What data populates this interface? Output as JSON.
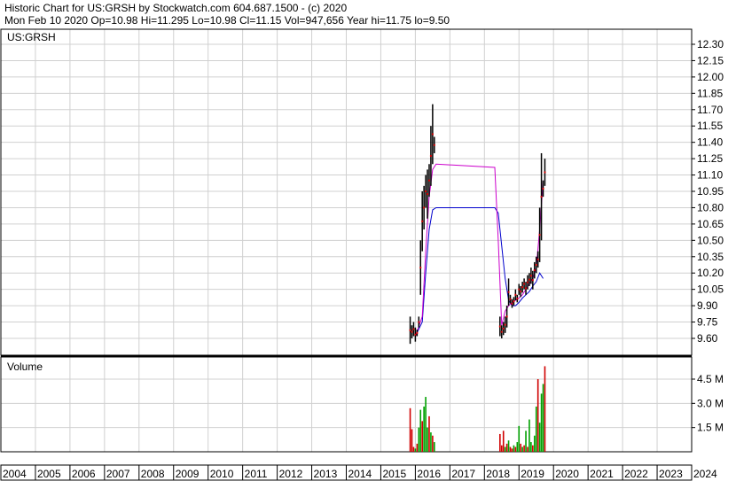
{
  "header": {
    "line1": "Historic Chart for US:GRSH by Stockwatch.com 604.687.1500 - (c) 2020",
    "line2": "Mon Feb 10 2020   Op=10.98  Hi=11.295  Lo=10.98  Cl=11.15  Vol=947,656  Year hi=11.75  lo=9.50"
  },
  "chart_data": [
    {
      "type": "line",
      "title": "US:GRSH",
      "xlabel": "",
      "ylabel": "",
      "x_ticks": [
        "2004",
        "2005",
        "2006",
        "2007",
        "2008",
        "2009",
        "2010",
        "2011",
        "2012",
        "2013",
        "2014",
        "2015",
        "2016",
        "2017",
        "2018",
        "2019",
        "2020",
        "2021",
        "2022",
        "2023",
        "2024"
      ],
      "y_ticks": [
        "9.60",
        "9.75",
        "9.90",
        "10.05",
        "10.20",
        "10.35",
        "10.50",
        "10.65",
        "10.80",
        "10.95",
        "11.10",
        "11.25",
        "11.40",
        "11.55",
        "11.70",
        "11.85",
        "12.00",
        "12.15",
        "12.30"
      ],
      "ylim": [
        9.45,
        12.38
      ],
      "grid": true,
      "colors": {
        "price": "#000000",
        "ma_short": "#0000cc",
        "ma_long": "#cc00cc",
        "up_volume": "#00a000",
        "down_volume": "#d00000"
      },
      "series": [
        {
          "style": "price-bars",
          "x": [
            2015.85,
            2015.9,
            2015.95,
            2016.0,
            2016.05,
            2016.1,
            2016.15,
            2016.2,
            2016.25,
            2016.3,
            2016.35,
            2016.4,
            2016.45,
            2016.5,
            2016.55,
            2018.45,
            2018.5,
            2018.55,
            2018.6,
            2018.65,
            2018.7,
            2018.75,
            2018.8,
            2018.85,
            2018.9,
            2018.95,
            2019.0,
            2019.05,
            2019.1,
            2019.15,
            2019.2,
            2019.25,
            2019.3,
            2019.35,
            2019.4,
            2019.45,
            2019.5,
            2019.55,
            2019.6,
            2019.65,
            2019.7,
            2019.75
          ],
          "low": [
            9.55,
            9.6,
            9.62,
            9.57,
            9.62,
            9.7,
            10.0,
            10.4,
            10.6,
            10.8,
            10.7,
            10.9,
            11.0,
            11.2,
            11.3,
            9.62,
            9.6,
            9.63,
            9.65,
            9.7,
            9.9,
            9.92,
            9.88,
            9.9,
            9.95,
            9.93,
            10.0,
            9.98,
            10.02,
            10.05,
            10.0,
            10.05,
            10.08,
            10.1,
            10.05,
            10.15,
            10.2,
            10.25,
            10.3,
            10.5,
            10.9,
            11.0
          ],
          "high": [
            9.8,
            9.72,
            9.75,
            9.7,
            9.68,
            9.8,
            10.5,
            10.95,
            11.0,
            11.1,
            11.15,
            11.2,
            11.55,
            11.75,
            11.45,
            9.8,
            9.72,
            9.75,
            9.8,
            9.9,
            10.15,
            10.0,
            9.96,
            9.98,
            10.05,
            10.0,
            10.1,
            10.08,
            10.12,
            10.15,
            10.12,
            10.18,
            10.2,
            10.25,
            10.22,
            10.3,
            10.35,
            10.4,
            10.8,
            11.3,
            11.05,
            11.25
          ]
        },
        {
          "name": "",
          "style": "moving-average-short",
          "x": [
            2016.0,
            2016.2,
            2016.3,
            2016.4,
            2016.5,
            2016.6,
            2018.3,
            2018.4,
            2018.5,
            2018.6,
            2018.7,
            2018.8,
            2018.9,
            2019.0,
            2019.1,
            2019.2,
            2019.3,
            2019.4,
            2019.5,
            2019.6,
            2019.7
          ],
          "values": [
            9.62,
            9.75,
            10.2,
            10.6,
            10.78,
            10.8,
            10.8,
            10.75,
            10.45,
            10.15,
            9.95,
            9.9,
            9.9,
            9.93,
            9.97,
            10.0,
            10.03,
            10.08,
            10.12,
            10.2,
            10.15
          ]
        },
        {
          "name": "",
          "style": "moving-average-long",
          "x": [
            2016.0,
            2016.2,
            2016.3,
            2016.4,
            2016.5,
            2016.6,
            2018.3,
            2018.4,
            2018.5,
            2018.6,
            2018.7,
            2018.8,
            2018.9,
            2019.0,
            2019.1,
            2019.2,
            2019.3,
            2019.4,
            2019.5,
            2019.6,
            2019.7
          ],
          "values": [
            9.62,
            9.8,
            10.4,
            10.9,
            11.15,
            11.2,
            11.17,
            10.5,
            9.72,
            9.85,
            9.9,
            9.93,
            9.95,
            9.97,
            10.0,
            10.05,
            10.1,
            10.15,
            10.25,
            10.6,
            11.05
          ]
        }
      ]
    },
    {
      "type": "bar",
      "title": "Volume",
      "y_ticks": [
        "1.5 M",
        "3.0 M",
        "4.5 M"
      ],
      "ylim": [
        0,
        5.5
      ],
      "unit": "M",
      "x_ticks": [
        "2004",
        "2005",
        "2006",
        "2007",
        "2008",
        "2009",
        "2010",
        "2011",
        "2012",
        "2013",
        "2014",
        "2015",
        "2016",
        "2017",
        "2018",
        "2019",
        "2020",
        "2021",
        "2022",
        "2023",
        "2024"
      ],
      "bars": {
        "x": [
          2015.85,
          2015.9,
          2015.95,
          2016.0,
          2016.05,
          2016.1,
          2016.15,
          2016.2,
          2016.25,
          2016.3,
          2016.35,
          2016.4,
          2016.45,
          2016.5,
          2016.55,
          2018.45,
          2018.5,
          2018.55,
          2018.6,
          2018.65,
          2018.7,
          2018.75,
          2018.8,
          2018.85,
          2018.9,
          2018.95,
          2019.0,
          2019.05,
          2019.1,
          2019.15,
          2019.2,
          2019.25,
          2019.3,
          2019.35,
          2019.4,
          2019.45,
          2019.5,
          2019.55,
          2019.6,
          2019.65,
          2019.7,
          2019.75
        ],
        "values": [
          2.7,
          1.4,
          0.3,
          0.2,
          0.5,
          1.5,
          2.6,
          1.9,
          2.8,
          3.4,
          1.5,
          2.2,
          1.2,
          1.0,
          0.6,
          1.1,
          0.4,
          1.3,
          0.3,
          0.5,
          0.7,
          0.3,
          0.2,
          0.4,
          0.3,
          0.6,
          1.6,
          0.5,
          0.3,
          0.4,
          1.3,
          0.3,
          2.0,
          0.6,
          0.4,
          1.0,
          2.8,
          4.5,
          1.8,
          3.6,
          4.2,
          5.3
        ],
        "up": [
          false,
          false,
          false,
          true,
          false,
          true,
          true,
          false,
          true,
          true,
          true,
          false,
          true,
          false,
          true,
          false,
          false,
          false,
          true,
          false,
          true,
          false,
          false,
          true,
          false,
          true,
          true,
          false,
          true,
          false,
          true,
          false,
          true,
          true,
          false,
          true,
          true,
          false,
          true,
          true,
          true,
          false
        ]
      }
    }
  ]
}
